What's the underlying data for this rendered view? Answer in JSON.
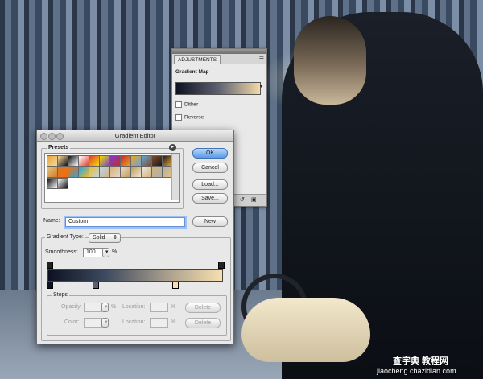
{
  "adjustments": {
    "tab": "ADJUSTMENTS",
    "menu_icon": "panel-menu-icon",
    "title": "Gradient Map",
    "gradient_colors": [
      "#0d1222",
      "#5c6070",
      "#f5d9a8"
    ],
    "dither_label": "Dither",
    "reverse_label": "Reverse"
  },
  "gradient_editor": {
    "title": "Gradient Editor",
    "presets_label": "Presets",
    "preset_swatch_colors": [
      [
        "#e7a63a",
        "#f7d9a0",
        "#101010",
        "#ffffff",
        "#e23f2a",
        "#f0e000",
        "#7b3ccf",
        "#c8292b",
        "#e8a522",
        "#6aa7d8",
        "#7d4b2a",
        "#1a1a1a"
      ],
      [
        "#e5c27a",
        "#d07c2a",
        "#ff6b00",
        "#29a7e0",
        "#f2b92b",
        "#b7d7e8",
        "#d9b07c",
        "#e6d9c8",
        "#c29c55",
        "#ebe6da",
        "#d1b37a",
        "#b0b0b0"
      ],
      [
        "#101010",
        "#ffffff"
      ]
    ],
    "buttons": {
      "ok": "OK",
      "cancel": "Cancel",
      "load": "Load...",
      "save": "Save...",
      "new": "New",
      "delete_opacity": "Delete",
      "delete_color": "Delete"
    },
    "name_label": "Name:",
    "name_value": "Custom",
    "gradient_type_label": "Gradient Type:",
    "gradient_type_value": "Solid",
    "smoothness_label": "Smoothness:",
    "smoothness_value": "100",
    "smoothness_unit": "%",
    "gradient_colors": [
      "#0d1222",
      "#3f4b60",
      "#a59b8b",
      "#f7e0b0"
    ],
    "color_stop_colors": [
      "#0d1222",
      "#5a6070",
      "#f7e0b0"
    ],
    "stops_label": "Stops",
    "opacity_label": "Opacity:",
    "percent_unit": "%",
    "location_label": "Location:",
    "color_label": "Color:"
  },
  "watermark": {
    "text": "查字典 教程网",
    "url": "jiaocheng.chazidian.com"
  }
}
